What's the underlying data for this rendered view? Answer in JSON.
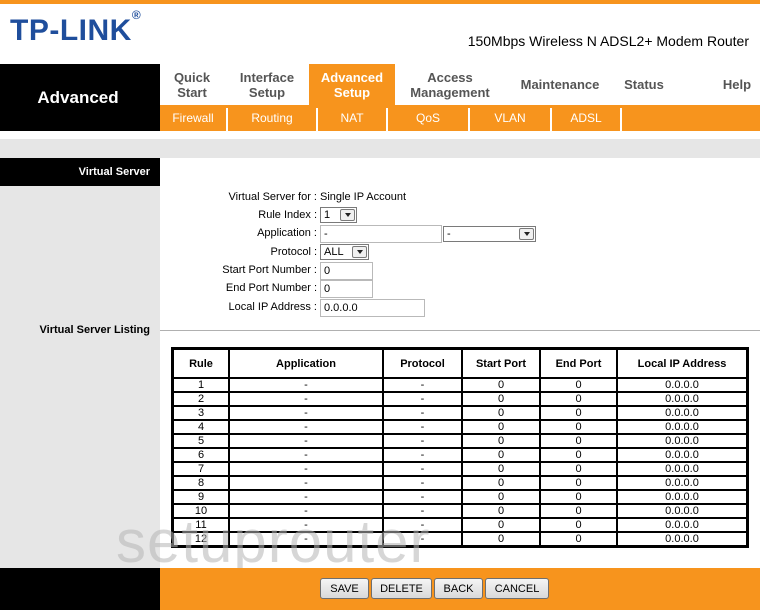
{
  "brand": {
    "logo": "TP-LINK",
    "model": "150Mbps Wireless N ADSL2+ Modem Router"
  },
  "nav": {
    "section": "Advanced",
    "menu": [
      {
        "label_line1": "Quick",
        "label_line2": "Start"
      },
      {
        "label_line1": "Interface",
        "label_line2": "Setup"
      },
      {
        "label_line1": "Advanced",
        "label_line2": "Setup"
      },
      {
        "label_line1": "Access",
        "label_line2": "Management"
      },
      {
        "label_line1": "Maintenance",
        "label_line2": ""
      },
      {
        "label_line1": "Status",
        "label_line2": ""
      },
      {
        "label_line1": "Help",
        "label_line2": ""
      }
    ],
    "submenu": [
      "Firewall",
      "Routing",
      "NAT",
      "QoS",
      "VLAN",
      "ADSL"
    ]
  },
  "side": {
    "title": "Virtual Server",
    "listing_title": "Virtual Server Listing"
  },
  "form": {
    "vs_for_label": "Virtual Server for :",
    "vs_for_value": "Single IP Account",
    "rule_index_label": "Rule Index :",
    "rule_index_value": "1",
    "application_label": "Application :",
    "application_value": "-",
    "application_select": "-",
    "protocol_label": "Protocol :",
    "protocol_value": "ALL",
    "start_port_label": "Start Port Number :",
    "start_port_value": "0",
    "end_port_label": "End Port Number :",
    "end_port_value": "0",
    "local_ip_label": "Local IP Address :",
    "local_ip_value": "0.0.0.0"
  },
  "table": {
    "headers": [
      "Rule",
      "Application",
      "Protocol",
      "Start Port",
      "End Port",
      "Local IP Address"
    ],
    "rows": [
      [
        "1",
        "-",
        "-",
        "0",
        "0",
        "0.0.0.0"
      ],
      [
        "2",
        "-",
        "-",
        "0",
        "0",
        "0.0.0.0"
      ],
      [
        "3",
        "-",
        "-",
        "0",
        "0",
        "0.0.0.0"
      ],
      [
        "4",
        "-",
        "-",
        "0",
        "0",
        "0.0.0.0"
      ],
      [
        "5",
        "-",
        "-",
        "0",
        "0",
        "0.0.0.0"
      ],
      [
        "6",
        "-",
        "-",
        "0",
        "0",
        "0.0.0.0"
      ],
      [
        "7",
        "-",
        "-",
        "0",
        "0",
        "0.0.0.0"
      ],
      [
        "8",
        "-",
        "-",
        "0",
        "0",
        "0.0.0.0"
      ],
      [
        "9",
        "-",
        "-",
        "0",
        "0",
        "0.0.0.0"
      ],
      [
        "10",
        "-",
        "-",
        "0",
        "0",
        "0.0.0.0"
      ],
      [
        "11",
        "-",
        "-",
        "0",
        "0",
        "0.0.0.0"
      ],
      [
        "12",
        "-",
        "-",
        "0",
        "0",
        "0.0.0.0"
      ]
    ]
  },
  "buttons": {
    "save": "SAVE",
    "delete": "DELETE",
    "back": "BACK",
    "cancel": "CANCEL"
  },
  "watermark": "setuprouter",
  "colors": {
    "accent": "#f7941d",
    "brand": "#1f4e9c",
    "dark": "#000000",
    "panel": "#e6e6e6"
  }
}
